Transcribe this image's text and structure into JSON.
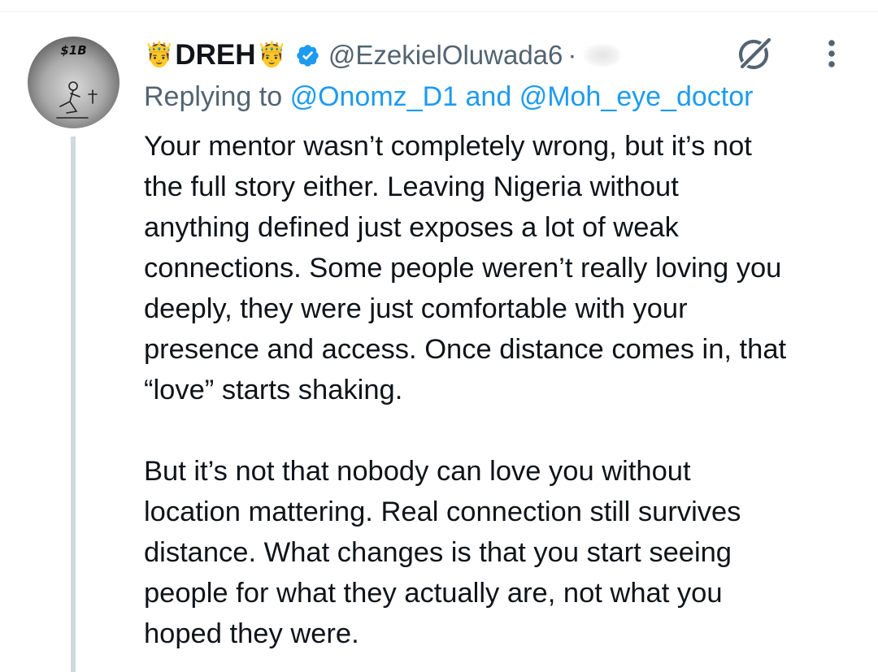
{
  "avatar": {
    "label": "$1B"
  },
  "author": {
    "crown_left": "🤴",
    "display_name": "DREH",
    "crown_right": "🤴",
    "handle": "@EzekielOluwada6",
    "separator": "·"
  },
  "icons": {
    "verified": "verified-badge-icon",
    "grok": "grok-icon",
    "more": "more-options-icon"
  },
  "reply_context": {
    "prefix": "Replying to",
    "mention_1": "@Onomz_D1",
    "conjunction": "and",
    "mention_2": "@Moh_eye_doctor"
  },
  "post": {
    "paragraphs": [
      "Your mentor wasn’t completely wrong, but it’s not\nthe full story either. Leaving Nigeria without\nanything defined just exposes a lot of weak\nconnections. Some people weren’t really loving you\ndeeply, they were just comfortable with your\npresence and access. Once distance comes in, that\n“love” starts shaking.",
      "But it’s not that nobody can love you without\nlocation mattering. Real connection still survives\ndistance. What changes is that you start seeing\npeople for what they actually are, not what you\nhoped they were."
    ]
  },
  "colors": {
    "text": "#0f1419",
    "secondary": "#536471",
    "link": "#1d9bf0",
    "thread_line": "#cfd9de",
    "verified": "#1d9bf0"
  }
}
